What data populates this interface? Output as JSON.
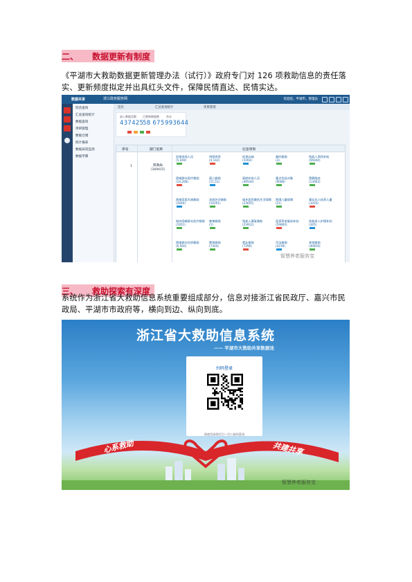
{
  "section2": {
    "num": "二、",
    "title": "数据更新有制度"
  },
  "para1": "《平湖市大救助数据更新管理办法（试行）》政府专门对 126 项救助信息的责任落实、更新频度拟定并出具红头文件，保障民情直达、民情实达。",
  "shot1": {
    "brand": "数据共享",
    "brand2": "浙江政务服务网",
    "util": "欢迎您，平湖市，管理员",
    "side_items": [
      "综合查询",
      "汇总查询统计",
      "数据查询",
      "项目管理",
      "数据仓储",
      "统计报表",
      "数据异常监测",
      "数据字典"
    ],
    "tabs": [
      "首页",
      "汇总查询统计",
      "项目管理"
    ],
    "stats": [
      {
        "label": "录入数据总数",
        "value": "437425"
      },
      {
        "label": "已更新数据数",
        "value": "58 675"
      },
      {
        "label": "合计",
        "value": "993644"
      }
    ],
    "table_headers": [
      "序号",
      "部门名称",
      "信息项目"
    ],
    "seq": "1",
    "dept": "民政局",
    "dept_count": "（349415）",
    "cells": [
      {
        "name": "民政低保人员",
        "count": "(5,049)"
      },
      {
        "name": "特困供养",
        "count": "(4,142)"
      },
      {
        "name": "低保边缘",
        "count": "(1064)"
      },
      {
        "name": "临时救助",
        "count": "(3)"
      },
      {
        "name": "残疾人两项补贴",
        "count": "(56044)"
      },
      {
        "name": "困难群众医疗救助",
        "count": "(14,268)"
      },
      {
        "name": "孤儿救助",
        "count": "(11,51)"
      },
      {
        "name": "高龄补贴人员",
        "count": "(49544)"
      },
      {
        "name": "重点优抚对象",
        "count": "(9086)"
      },
      {
        "name": "殡葬服务",
        "count": "(13063)"
      },
      {
        "name": "困难家庭大病救助",
        "count": "(2849)"
      },
      {
        "name": "流浪乞讨救助",
        "count": "(10201)"
      },
      {
        "name": "城乡居民最低生活保障",
        "count": "(23655)"
      },
      {
        "name": "困境儿童保障",
        "count": "(21)"
      },
      {
        "name": "事实无人抚养儿童",
        "count": "(3203)"
      },
      {
        "name": "城乡困难群众医疗救助",
        "count": "(1951)"
      },
      {
        "name": "慈善救助",
        "count": "(1)"
      },
      {
        "name": "残疾人康复救助",
        "count": "(23912)"
      },
      {
        "name": "居家养老服务补贴",
        "count": "(59800)"
      },
      {
        "name": "失能老人护理补贴",
        "count": "(345)"
      },
      {
        "name": "困难群众住房救助",
        "count": "(6,560)"
      },
      {
        "name": "教育救助",
        "count": "(7304)"
      },
      {
        "name": "就业援助",
        "count": "(7290)"
      },
      {
        "name": "司法救助",
        "count": "(4239)"
      },
      {
        "name": "其他救助",
        "count": "(40819)"
      }
    ],
    "watermark": "智慧养老服务宝"
  },
  "section3": {
    "num": "三、",
    "title": "救助探索有深度"
  },
  "para2": "系统作为浙江省大救助信息系统重要组成部分，信息对接浙江省民政厅、嘉兴市民政局、平湖市市政府等，横向到边、纵向到底。",
  "shot2": {
    "title": "浙江省大救助信息系统",
    "subtitle": "—— 平湖市大救助共享数据池",
    "card_caption": "扫码登录",
    "card_footer": "请使用浙政钉扫一扫二维码登录",
    "ribbon_left": "心系救助",
    "ribbon_right": "共建共享",
    "watermark": "智慧养老服务宝"
  }
}
